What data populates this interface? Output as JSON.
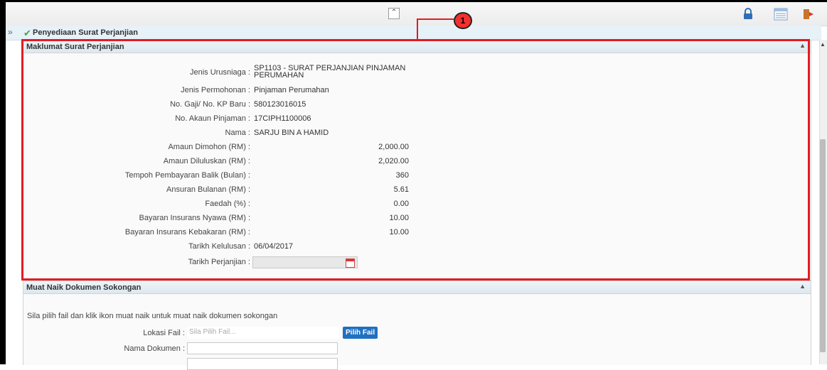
{
  "toolbar": {
    "collapse_glyph": "«",
    "icons": [
      "lock-icon",
      "grid-view-icon",
      "exit-icon"
    ]
  },
  "breadcrumb": {
    "title": "Penyediaan Surat Perjanjian"
  },
  "callout": {
    "number": "1"
  },
  "section_agreement": {
    "title": "Maklumat Surat Perjanjian",
    "fields": [
      {
        "label": "Jenis Urusniaga :",
        "value_line1": "SP1103 - SURAT PERJANJIAN PINJAMAN",
        "value_line2": "PERUMAHAN"
      },
      {
        "label": "Jenis Permohonan :",
        "value": "Pinjaman Perumahan"
      },
      {
        "label": "No. Gaji/ No. KP Baru :",
        "value": "580123016015"
      },
      {
        "label": "No. Akaun Pinjaman :",
        "value": "17CIPH1100006"
      },
      {
        "label": "Nama :",
        "value": "SARJU BIN A HAMID"
      },
      {
        "label": "Amaun Dimohon (RM) :",
        "value": "2,000.00"
      },
      {
        "label": "Amaun Diluluskan (RM) :",
        "value": "2,020.00"
      },
      {
        "label": "Tempoh Pembayaran Balik (Bulan) :",
        "value": "360"
      },
      {
        "label": "Ansuran Bulanan (RM) :",
        "value": "5.61"
      },
      {
        "label": "Faedah (%) :",
        "value": "0.00"
      },
      {
        "label": "Bayaran Insurans Nyawa (RM) :",
        "value": "10.00"
      },
      {
        "label": "Bayaran Insurans Kebakaran (RM) :",
        "value": "10.00"
      },
      {
        "label": "Tarikh Kelulusan :",
        "value": "06/04/2017"
      },
      {
        "label": "Tarikh Perjanjian :",
        "value": ""
      }
    ]
  },
  "section_upload": {
    "title": "Muat Naik Dokumen Sokongan",
    "hint": "Sila pilih fail dan klik ikon muat naik untuk muat naik dokumen sokongan",
    "file_label": "Lokasi Fail :",
    "file_placeholder": "Sila Pilih Fail...",
    "file_button": "Pilih Fail",
    "doc_label": "Nama Dokumen :"
  },
  "colors": {
    "highlight": "#e31b23",
    "button": "#1f70c2",
    "header_bg": "#e6f1f8"
  }
}
